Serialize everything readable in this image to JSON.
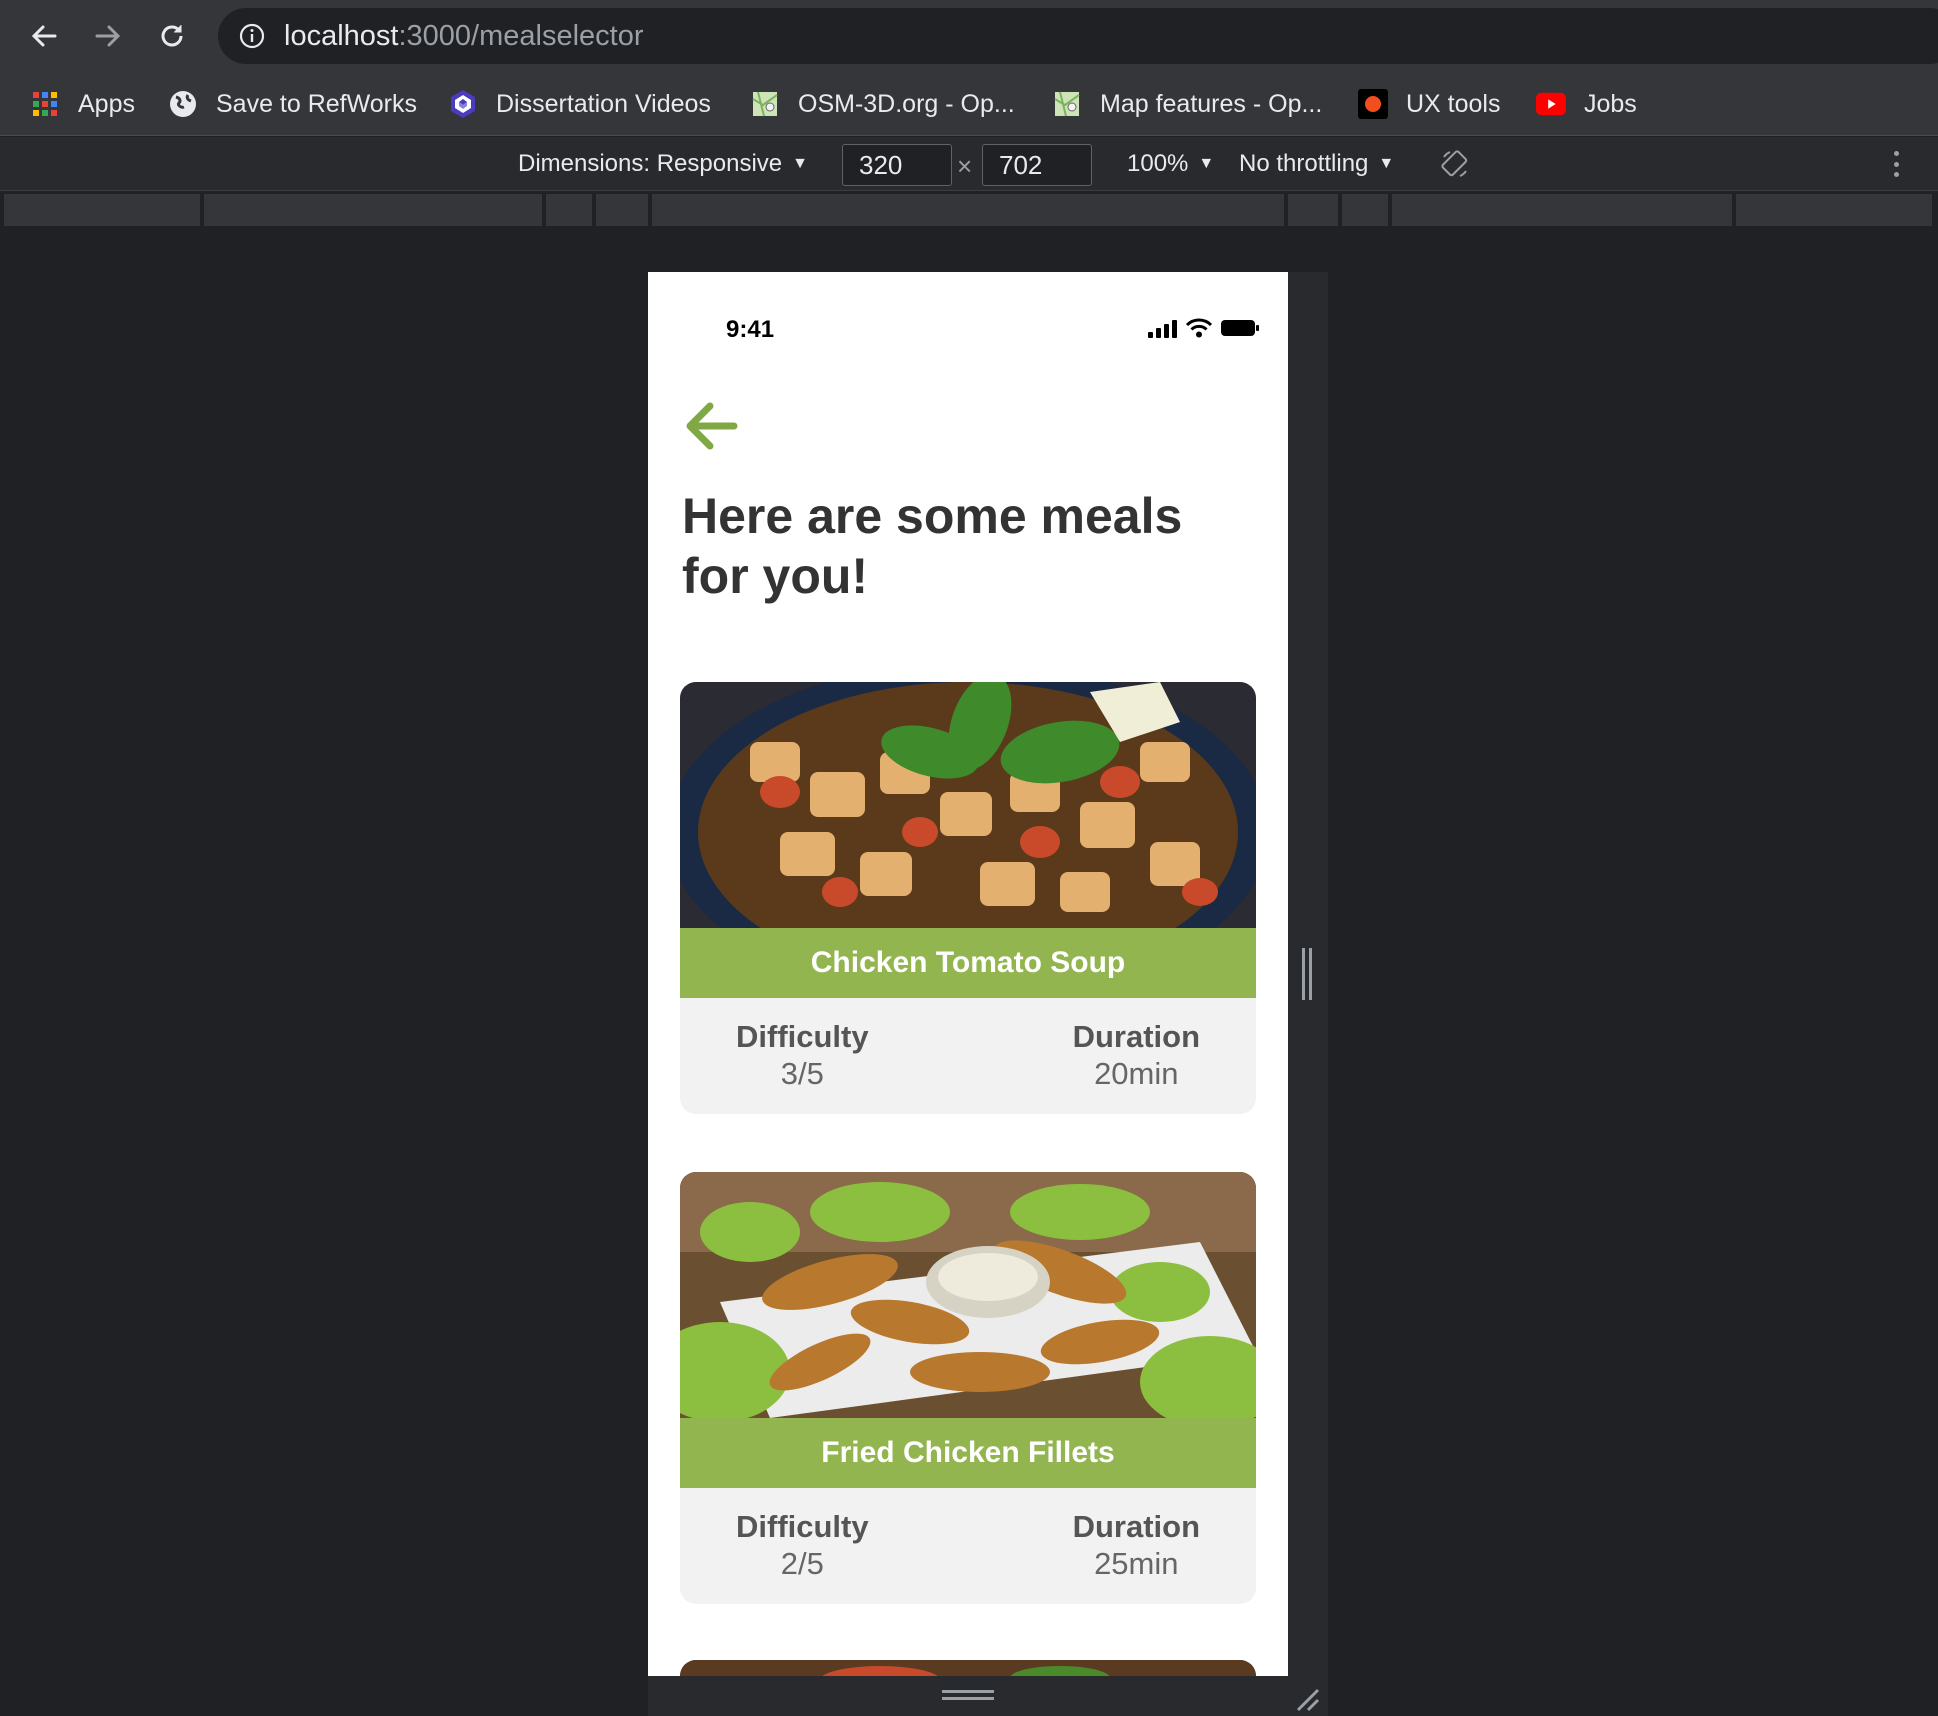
{
  "browser": {
    "url_host": "localhost",
    "url_path": ":3000/mealselector",
    "bookmarks": [
      {
        "label": "Apps",
        "icon": "apps-grid-icon"
      },
      {
        "label": "Save to RefWorks",
        "icon": "globe-icon"
      },
      {
        "label": "Dissertation Videos",
        "icon": "hexagon-logo-icon"
      },
      {
        "label": "OSM-3D.org - Op...",
        "icon": "map-icon"
      },
      {
        "label": "Map features - Op...",
        "icon": "map-icon"
      },
      {
        "label": "UX tools",
        "icon": "record-dot-icon"
      },
      {
        "label": "Jobs",
        "icon": "youtube-icon"
      }
    ]
  },
  "devtools": {
    "dimensions_label": "Dimensions: Responsive",
    "width_value": "320",
    "height_value": "702",
    "zoom": "100%",
    "throttling": "No throttling"
  },
  "app": {
    "status_time": "9:41",
    "heading": "Here are some meals for you!",
    "colors": {
      "accent": "#93b550",
      "heading": "#333333"
    },
    "meals": [
      {
        "name": "Chicken Tomato Soup",
        "difficulty_label": "Difficulty",
        "difficulty": "3/5",
        "duration_label": "Duration",
        "duration": "20min"
      },
      {
        "name": "Fried Chicken Fillets",
        "difficulty_label": "Difficulty",
        "difficulty": "2/5",
        "duration_label": "Duration",
        "duration": "25min"
      }
    ]
  }
}
